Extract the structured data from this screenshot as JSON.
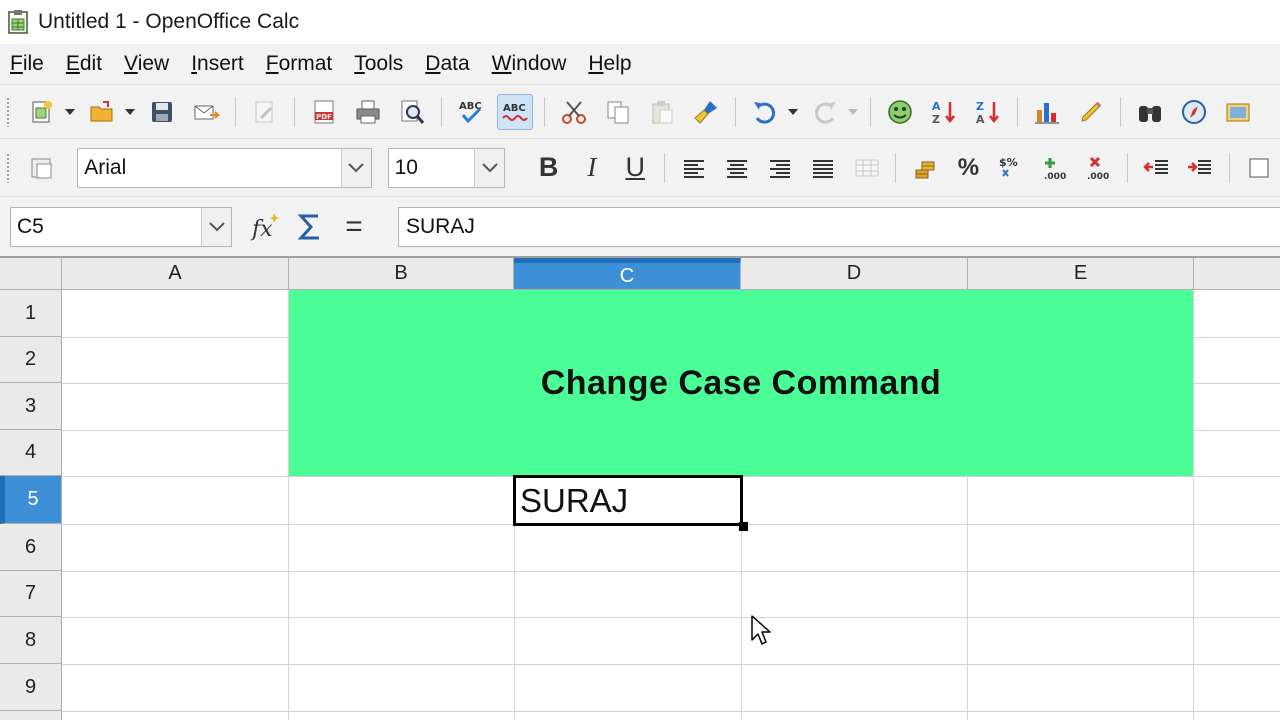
{
  "window": {
    "title": "Untitled 1 - OpenOffice Calc"
  },
  "menu": [
    {
      "first": "F",
      "rest": "ile"
    },
    {
      "first": "E",
      "rest": "dit"
    },
    {
      "first": "V",
      "rest": "iew"
    },
    {
      "first": "I",
      "rest": "nsert"
    },
    {
      "first": "F",
      "rest": "ormat"
    },
    {
      "first": "T",
      "rest": "ools"
    },
    {
      "first": "D",
      "rest": "ata"
    },
    {
      "first": "W",
      "rest": "indow"
    },
    {
      "first": "H",
      "rest": "elp"
    }
  ],
  "formatting": {
    "font_name": "Arial",
    "font_size": "10",
    "bold": "B",
    "italic": "I",
    "underline": "U",
    "percent": "%"
  },
  "formula_bar": {
    "name_box": "C5",
    "equals": "=",
    "content": "SURAJ"
  },
  "sheet": {
    "columns": [
      "A",
      "B",
      "C",
      "D",
      "E"
    ],
    "selected_column": "C",
    "rows": [
      "1",
      "2",
      "3",
      "4",
      "5",
      "6",
      "7",
      "8",
      "9"
    ],
    "selected_row": "5",
    "merged_title": "Change Case Command",
    "merged_fill_color": "#4bfd96",
    "active_cell_value": "SURAJ"
  },
  "colors": {
    "selection_header": "#3d8fd6",
    "toolbar_bg": "#f2f2f2"
  }
}
